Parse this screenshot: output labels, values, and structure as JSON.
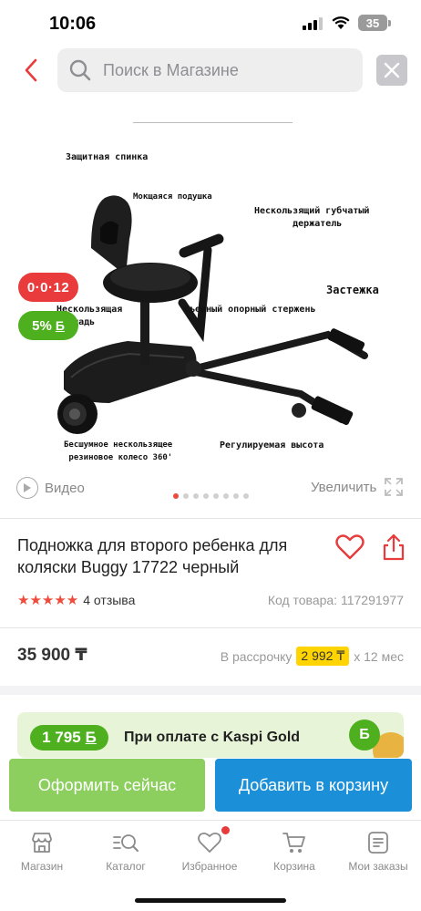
{
  "status": {
    "time": "10:06",
    "battery": "35"
  },
  "search": {
    "placeholder": "Поиск в Магазине"
  },
  "image": {
    "annotations": {
      "back": "Защитная спинка",
      "cushion": "Мокщаяся подушка",
      "grip": "Нескользящий губчатый\n       держатель",
      "clasp": "Застежка",
      "platform": "Нескользящая\nплощадь",
      "rod": "Съемный опорный стержень",
      "wheel": "Бесшумное нескользящее\n резиновое колесо 360'",
      "height": "Регулируемая высота"
    },
    "badge_installment": "0·0·12",
    "badge_bonus": "5%",
    "badge_bonus_icon": "Б",
    "slides_total": 8,
    "slide_active": 1
  },
  "media": {
    "video_label": "Видео",
    "zoom_label": "Увеличить"
  },
  "product": {
    "title": "Подножка для второго ребенка для коляски Buggy 17722 черный",
    "rating_stars": "★★★★★",
    "rating": 5,
    "reviews": "4 отзыва",
    "sku": "Код товара: 117291977",
    "price": "35 900 ₸",
    "installment_prefix": "В рассрочку",
    "installment_amount": "2 992 ₸",
    "installment_suffix": "х 12 мес"
  },
  "kaspi_gold": {
    "bonus": "1 795",
    "bonus_icon": "Б",
    "text": "При оплате с Kaspi Gold"
  },
  "actions": {
    "order": "Оформить сейчас",
    "add_to_cart": "Добавить в корзину"
  },
  "tabs": [
    {
      "label": "Магазин",
      "icon": "store-icon"
    },
    {
      "label": "Каталог",
      "icon": "catalog-icon"
    },
    {
      "label": "Избранное",
      "icon": "heart-icon"
    },
    {
      "label": "Корзина",
      "icon": "cart-icon"
    },
    {
      "label": "Мои заказы",
      "icon": "orders-icon"
    }
  ],
  "colors": {
    "accent_red": "#e93b3b",
    "green": "#4eb01f",
    "blue": "#1b8fd8",
    "light_green": "#8ccf5f"
  }
}
